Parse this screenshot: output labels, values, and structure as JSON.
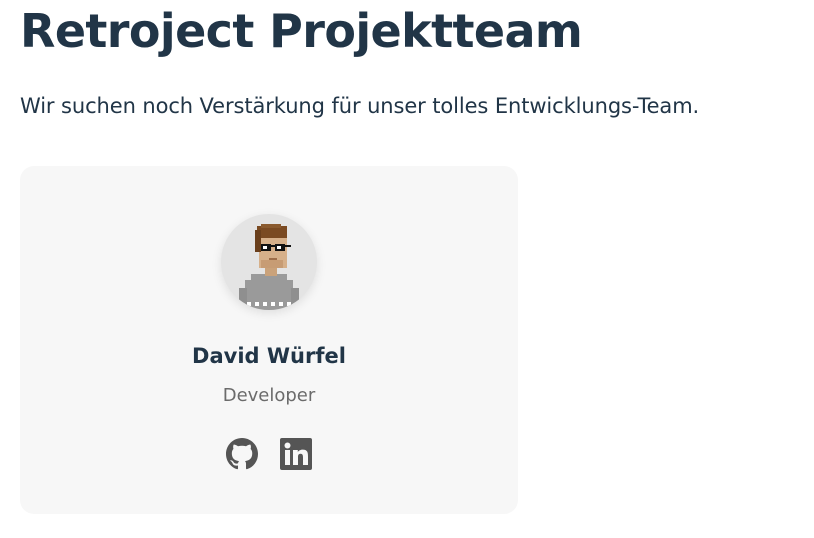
{
  "page": {
    "title": "Retroject Projektteam",
    "intro": "Wir suchen noch Verstärkung für unser tolles Entwicklungs-Team."
  },
  "team": [
    {
      "name": "David Würfel",
      "role": "Developer",
      "avatar_icon": "pixel-art-avatar-icon",
      "links": [
        {
          "icon": "github-icon"
        },
        {
          "icon": "linkedin-icon"
        }
      ]
    }
  ],
  "colors": {
    "heading": "#213547",
    "card_background": "#f7f7f7",
    "muted_text": "#6b6b6b",
    "icon": "#555555"
  }
}
